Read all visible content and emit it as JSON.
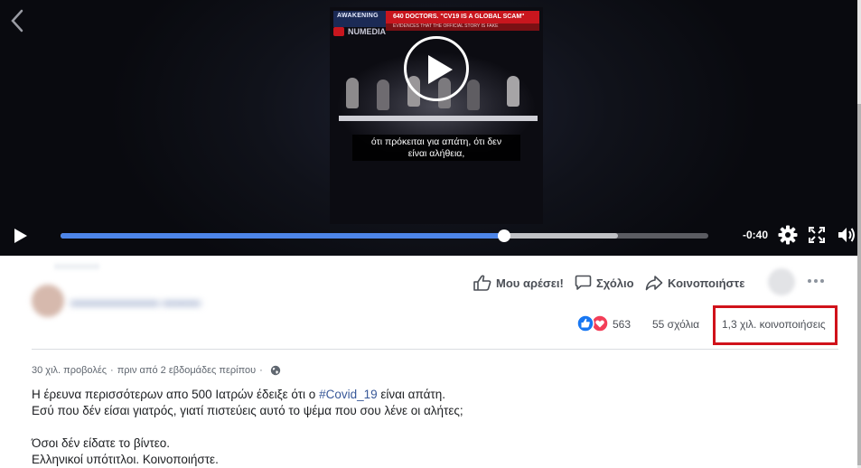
{
  "video": {
    "banner_brand": "AWAKENING",
    "banner_headline": "640 DOCTORS. \"CV19 IS A GLOBAL SCAM\"",
    "banner_sub": "EVIDENCES THAT THE OFFICIAL STORY IS FAKE",
    "logo_text": "NUMEDIA",
    "subtitle_line1": "ότι πρόκειται για απάτη, ότι δεν",
    "subtitle_line2": "είναι αλήθεια,",
    "time_remaining": "-0:40",
    "progress_fraction": 0.685,
    "buffered_fraction": 0.86
  },
  "actions": {
    "like_label": "Μου αρέσει!",
    "comment_label": "Σχόλιο",
    "share_label": "Κοινοποιήστε"
  },
  "stats": {
    "reactions_count": "563",
    "comments_count": "55 σχόλια",
    "shares_count": "1,3 χιλ. κοινοποιήσεις"
  },
  "meta": {
    "views": "30 χιλ. προβολές",
    "separator": "·",
    "time_ago": "πριν από 2 εβδομάδες περίπου",
    "separator2": "·"
  },
  "post": {
    "line1_before": "Η έρευνα περισσότερων απο 500 Ιατρών έδειξε ότι ο ",
    "hashtag": "#Covid_19",
    "line1_after": " είναι απάτη.",
    "line2": "Εσύ που δέν είσαι γιατρός, γιατί πιστεύεις αυτό το ψέμα που σου λένε οι αλήτες;",
    "line3": "Όσοι δέν είδατε το βίντεο.",
    "line4": "Ελληνικοί υπότιτλοι. Κοινοποιήστε."
  },
  "colors": {
    "progress": "#4d85e8",
    "highlight_box": "#d0121b",
    "link": "#385898",
    "like_blue": "#1877f2",
    "love_red": "#f33e58"
  }
}
